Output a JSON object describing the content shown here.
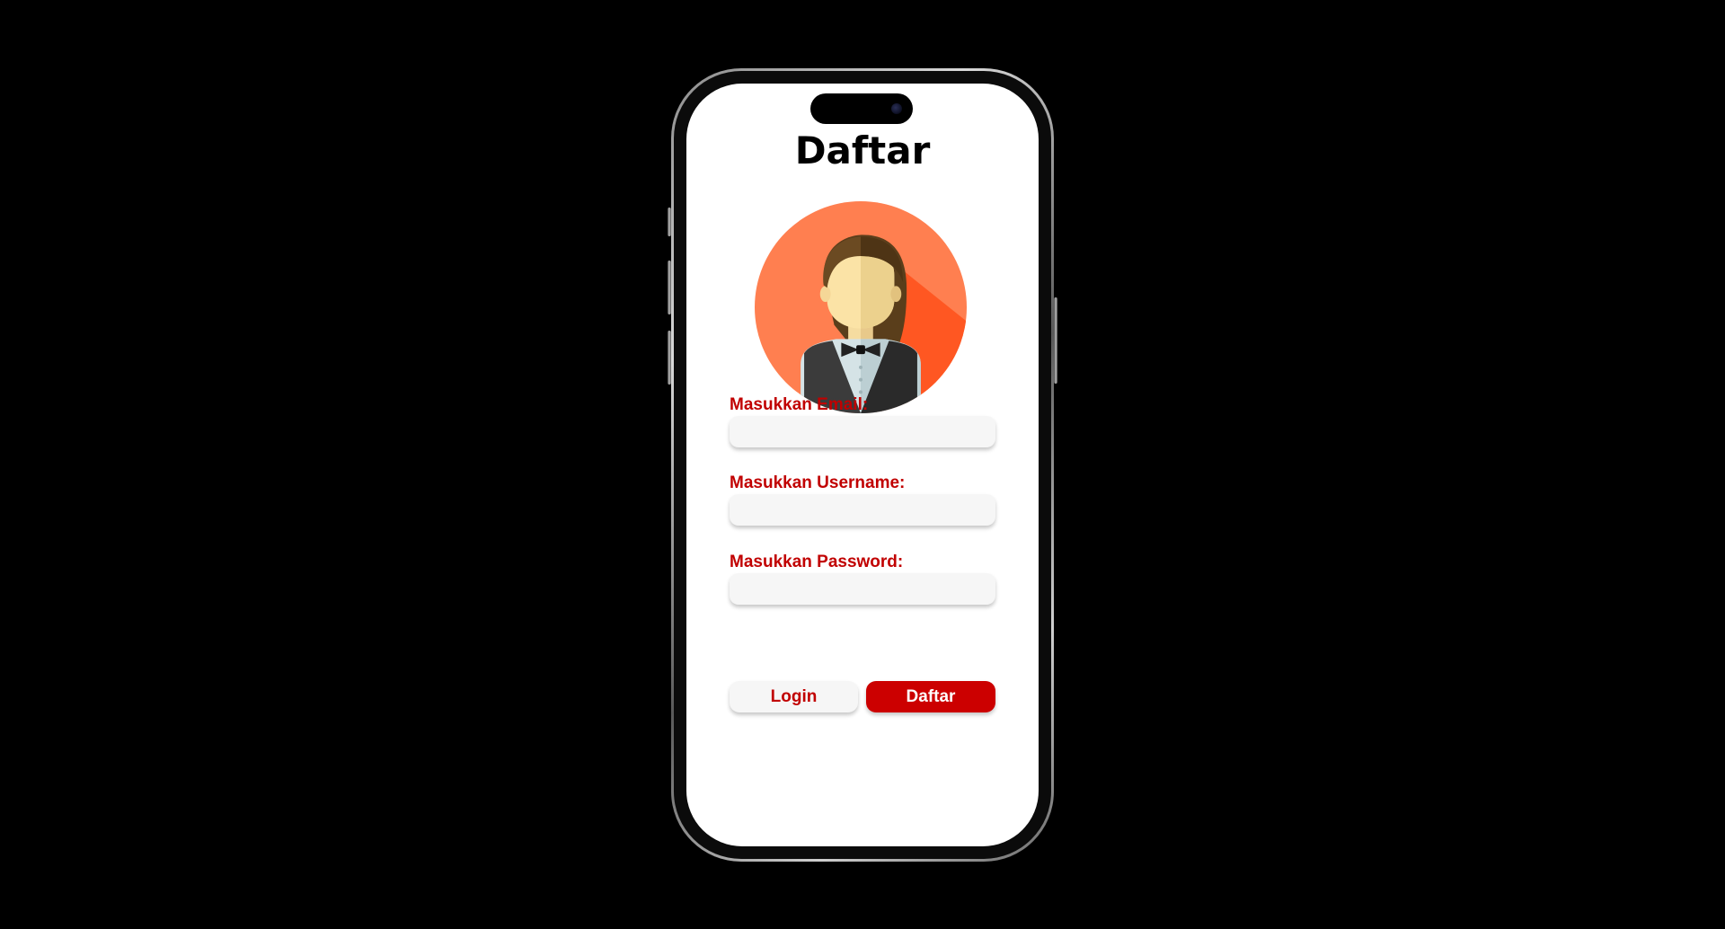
{
  "app": {
    "title": "Daftar"
  },
  "colors": {
    "background": "#000000",
    "screen": "#ffffff",
    "accent_red": "#cc0000",
    "label_red": "#c10000",
    "field_bg": "#f6f6f6",
    "avatar_circle": "#ff7f50"
  },
  "avatar": {
    "icon": "waitress-avatar-icon"
  },
  "form": {
    "email_label": "Masukkan Email:",
    "email_value": "",
    "username_label": "Masukkan Username:",
    "username_value": "",
    "password_label": "Masukkan Password:",
    "password_value": ""
  },
  "buttons": {
    "login_label": "Login",
    "daftar_label": "Daftar"
  }
}
